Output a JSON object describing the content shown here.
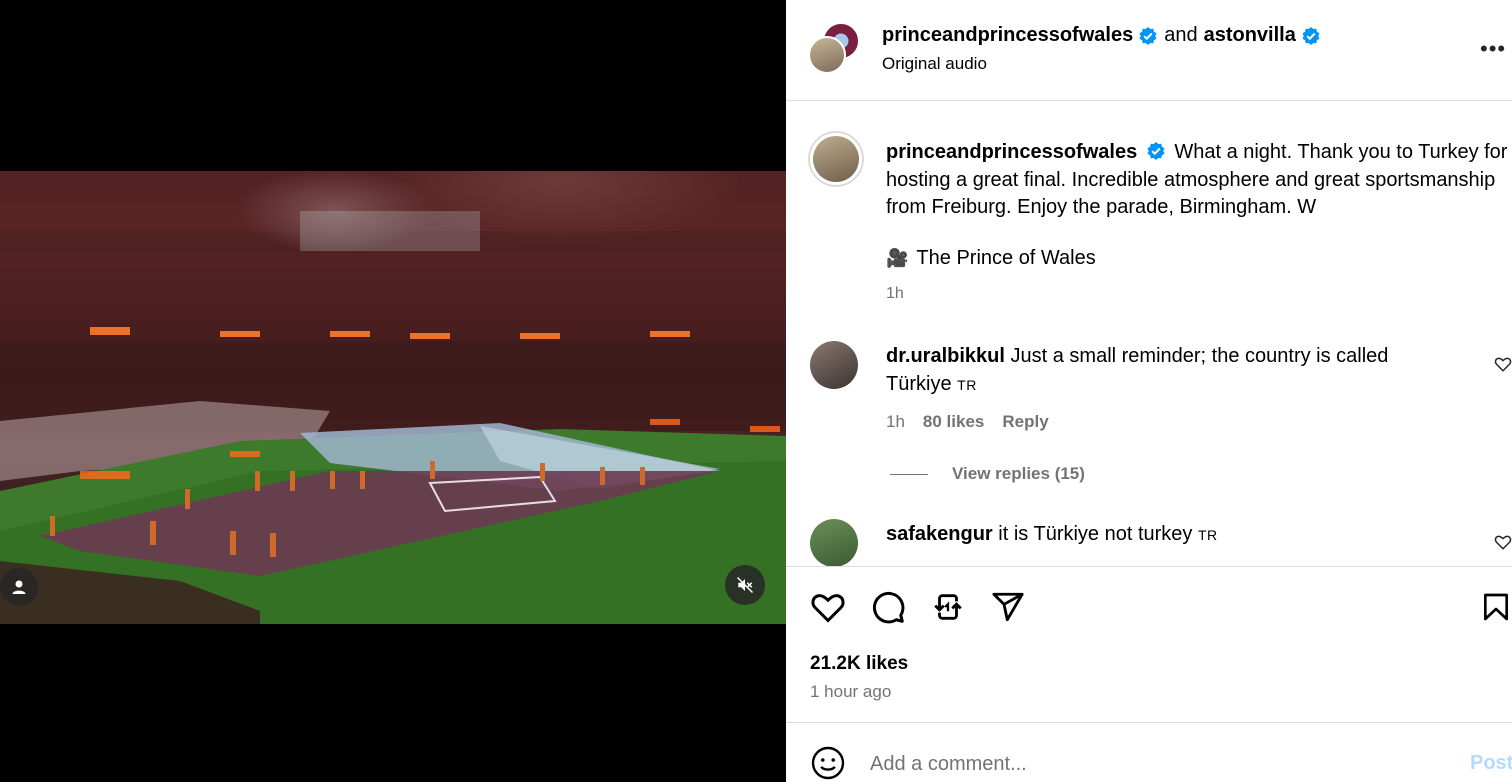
{
  "header": {
    "user1": "princeandprincessofwales",
    "and": "and",
    "user2": "astonvilla",
    "audio": "Original audio",
    "more": "•••"
  },
  "caption": {
    "username": "princeandprincessofwales",
    "text": "What a night. Thank you to Turkey for hosting a great final. Incredible atmosphere and great sportsmanship from Freiburg. Enjoy the parade, Birmingham. W",
    "credit_icon": "🎥",
    "credit": "The Prince of Wales",
    "time": "1h"
  },
  "comments": [
    {
      "username": "dr.uralbikkul",
      "text": "Just a small reminder; the country is called Türkiye",
      "flag": "TR",
      "time": "1h",
      "likes": "80 likes",
      "reply": "Reply",
      "view_replies": "View replies (15)"
    },
    {
      "username": "safakengur",
      "text": "it is Türkiye not turkey",
      "flag": "TR"
    }
  ],
  "actions": {
    "likes": "21.2K likes",
    "posted": "1 hour ago"
  },
  "comment_box": {
    "placeholder": "Add a comment...",
    "post": "Post"
  },
  "colors": {
    "verified": "#0095f6",
    "muted": "#737373",
    "border": "#dbdbdb",
    "post_disabled": "#b3dbff"
  },
  "icons": [
    "verified-badge-icon",
    "more-icon",
    "heart-icon",
    "comment-icon",
    "repost-icon",
    "share-icon",
    "bookmark-icon",
    "emoji-icon",
    "user-tag-icon",
    "mute-icon",
    "camera-icon"
  ]
}
